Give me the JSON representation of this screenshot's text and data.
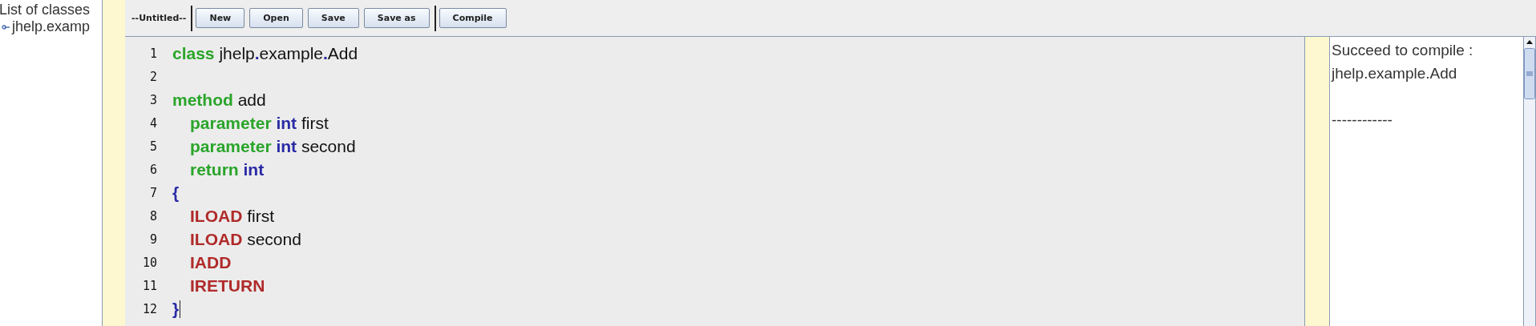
{
  "class_list": {
    "title": "List of classes",
    "items": [
      {
        "label": "jhelp.examp"
      }
    ]
  },
  "toolbar": {
    "file_name": "--Untitled--",
    "groups": [
      [
        "New",
        "Open",
        "Save",
        "Save as"
      ],
      [
        "Compile"
      ]
    ]
  },
  "editor": {
    "lines": [
      {
        "number": "1",
        "indent": false,
        "tokens": [
          {
            "kind": "keyword",
            "text": "class"
          },
          {
            "kind": "plain",
            "text": " jhelp"
          },
          {
            "kind": "punct",
            "text": "."
          },
          {
            "kind": "plain",
            "text": "example"
          },
          {
            "kind": "punct",
            "text": "."
          },
          {
            "kind": "plain",
            "text": "Add"
          }
        ]
      },
      {
        "number": "2"
      },
      {
        "number": "3",
        "indent": false,
        "tokens": [
          {
            "kind": "keyword",
            "text": "method"
          },
          {
            "kind": "plain",
            "text": " add"
          }
        ]
      },
      {
        "number": "4",
        "indent": true,
        "tokens": [
          {
            "kind": "keyword",
            "text": "parameter"
          },
          {
            "kind": "type",
            "text": " int"
          },
          {
            "kind": "plain",
            "text": " first"
          }
        ]
      },
      {
        "number": "5",
        "indent": true,
        "tokens": [
          {
            "kind": "keyword",
            "text": "parameter"
          },
          {
            "kind": "type",
            "text": " int"
          },
          {
            "kind": "plain",
            "text": " second"
          }
        ]
      },
      {
        "number": "6",
        "indent": true,
        "tokens": [
          {
            "kind": "keyword",
            "text": "return"
          },
          {
            "kind": "type",
            "text": " int"
          }
        ]
      },
      {
        "number": "7",
        "indent": false,
        "tokens": [
          {
            "kind": "punct",
            "text": "{"
          }
        ]
      },
      {
        "number": "8",
        "indent": true,
        "tokens": [
          {
            "kind": "instruction",
            "text": "ILOAD"
          },
          {
            "kind": "plain",
            "text": " first"
          }
        ]
      },
      {
        "number": "9",
        "indent": true,
        "tokens": [
          {
            "kind": "instruction",
            "text": "ILOAD"
          },
          {
            "kind": "plain",
            "text": " second"
          }
        ]
      },
      {
        "number": "10",
        "indent": true,
        "tokens": [
          {
            "kind": "instruction",
            "text": "IADD"
          }
        ]
      },
      {
        "number": "11",
        "indent": true,
        "tokens": [
          {
            "kind": "instruction",
            "text": "IRETURN"
          }
        ]
      },
      {
        "number": "12",
        "indent": false,
        "caret": true,
        "tokens": [
          {
            "kind": "punct",
            "text": "}"
          }
        ]
      }
    ]
  },
  "output": {
    "lines": [
      {
        "text": "Succeed to compile :"
      },
      {
        "text": "jhelp.example.Add"
      },
      {
        "text": "------------",
        "blank_before": true
      }
    ]
  }
}
